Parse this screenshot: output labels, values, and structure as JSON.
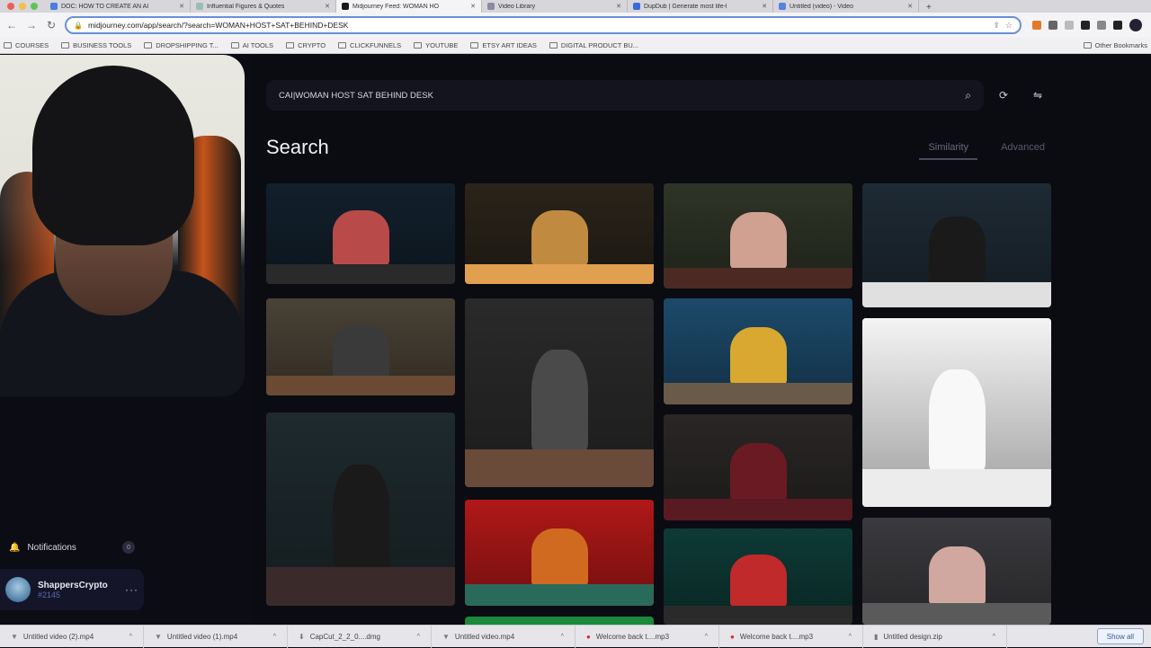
{
  "browser": {
    "tabs": [
      {
        "title": "DOC: HOW TO CREATE AN AI",
        "active": false,
        "favicon_color": "#4a7ee0"
      },
      {
        "title": "Influential Figures & Quotes",
        "active": false,
        "favicon_color": "#9bbcb0"
      },
      {
        "title": "Midjourney Feed: WOMAN HO",
        "active": true,
        "favicon_color": "#1a1a1a"
      },
      {
        "title": "Video Library",
        "active": false,
        "favicon_color": "#8a8aa0"
      },
      {
        "title": "DupDub | Generate most life-l",
        "active": false,
        "favicon_color": "#3a6ad8"
      },
      {
        "title": "Untitled (video) - Video",
        "active": false,
        "favicon_color": "#5a80e0"
      }
    ],
    "url": "midjourney.com/app/search/?search=WOMAN+HOST+SAT+BEHIND+DESK",
    "bookmarks": [
      "COURSES",
      "BUSINESS TOOLS",
      "DROPSHIPPING T...",
      "AI TOOLS",
      "CRYPTO",
      "CLICKFUNNELS",
      "YOUTUBE",
      "ETSY ART IDEAS",
      "Digital Product Bu..."
    ],
    "other_bookmarks": "Other Bookmarks",
    "extension_colors": [
      "#e07a2a",
      "#666666",
      "#bbbbbb",
      "#222222",
      "#888888",
      "#222222"
    ]
  },
  "sidebar": {
    "notifications_label": "Notifications",
    "notifications_count": "0",
    "user": {
      "name": "ShappersCrypto",
      "tag": "#2145"
    }
  },
  "main": {
    "search_value": "CAI|WOMAN HOST SAT BEHIND DESK",
    "page_title": "Search",
    "tabs": [
      {
        "label": "Similarity",
        "active": true
      },
      {
        "label": "Advanced",
        "active": false
      }
    ],
    "images": [
      {
        "desc": "girl at desk in dark studio",
        "bg": "#12202c",
        "accent": "#b84a4a",
        "desk": "#2a2a2a"
      },
      {
        "desc": "woman seen from behind in lit office",
        "bg": "#2a241a",
        "accent": "#c08a40",
        "desk": "#e0a050"
      },
      {
        "desc": "woman at desk in green room",
        "bg": "#2e3426",
        "accent": "#d0a090",
        "desk": "#4a2a22"
      },
      {
        "desc": "asian woman host smiling",
        "bg": "#1e2a34",
        "accent": "#1a1a1a",
        "desk": "#e0e0e0"
      },
      {
        "desc": "woman at table brown wall",
        "bg": "#4a4236",
        "accent": "#3a3a3a",
        "desk": "#6a4a34"
      },
      {
        "desc": "woman in grey blazer at desk",
        "bg": "#2a2a2a",
        "accent": "#4a4a4a",
        "desk": "#6a4a38"
      },
      {
        "desc": "figure in yellow blue room",
        "bg": "#1c4a6a",
        "accent": "#d8a830",
        "desk": "#6a5a4a"
      },
      {
        "desc": "woman in white shirt on white",
        "bg": "#f4f4f4",
        "accent": "#f8f8f8",
        "desk": "#ececec"
      },
      {
        "desc": "news anchor in black blazer",
        "bg": "#1e2a2e",
        "accent": "#1a1a1a",
        "desk": "#3a2a2a"
      },
      {
        "desc": "blonde anchor in red blazer",
        "bg": "#2a2626",
        "accent": "#6a1a22",
        "desk": "#5a1a22"
      },
      {
        "desc": "host in orange on red set",
        "bg": "#b01818",
        "accent": "#d06a20",
        "desk": "#2a6a5a"
      },
      {
        "desc": "woman in red teal studio",
        "bg": "#0e3a36",
        "accent": "#c02a2a",
        "desk": "#2a2a2a"
      },
      {
        "desc": "woman at glass desk city view",
        "bg": "#3a3a3e",
        "accent": "#d0a8a0",
        "desk": "#5a5a5a"
      },
      {
        "desc": "partial green image",
        "bg": "#1a8a3a",
        "accent": "#1a8a3a",
        "desk": "#1a8a3a"
      }
    ]
  },
  "downloads": [
    {
      "name": "Untitled video (2).mp4",
      "type": "video"
    },
    {
      "name": "Untitled video (1).mp4",
      "type": "video"
    },
    {
      "name": "CapCut_2_2_0....dmg",
      "type": "dmg"
    },
    {
      "name": "Untitled video.mp4",
      "type": "video"
    },
    {
      "name": "Welcome back t....mp3",
      "type": "audio"
    },
    {
      "name": "Welcome back t....mp3",
      "type": "audio"
    },
    {
      "name": "Untitled design.zip",
      "type": "zip"
    }
  ],
  "show_all_label": "Show all"
}
